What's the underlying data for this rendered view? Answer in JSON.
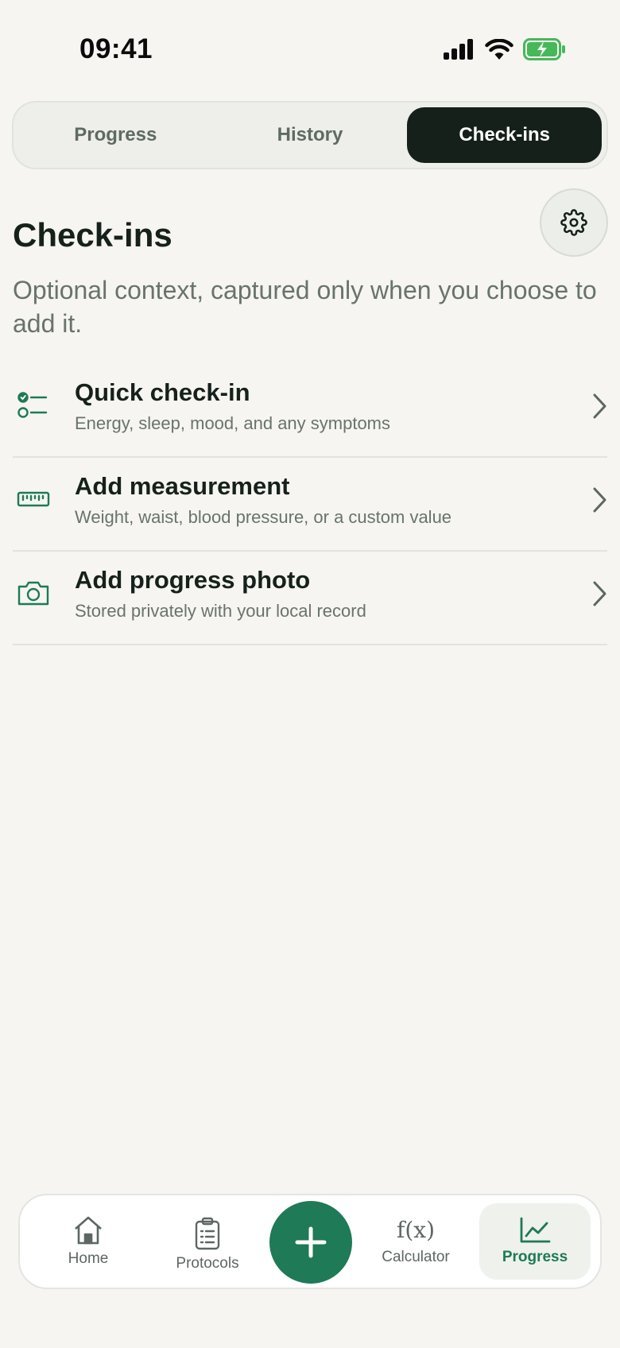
{
  "status_bar": {
    "time": "09:41"
  },
  "segments": [
    {
      "label": "Progress",
      "active": false
    },
    {
      "label": "History",
      "active": false
    },
    {
      "label": "Check-ins",
      "active": true
    }
  ],
  "page": {
    "title": "Check-ins",
    "subtitle": "Optional context, captured only when you choose to add it.",
    "settings_icon": "gear-icon"
  },
  "actions": [
    {
      "icon": "checklist-icon",
      "title": "Quick check-in",
      "description": "Energy, sleep, mood, and any symptoms"
    },
    {
      "icon": "ruler-icon",
      "title": "Add measurement",
      "description": "Weight, waist, blood pressure, or a custom value"
    },
    {
      "icon": "camera-icon",
      "title": "Add progress photo",
      "description": "Stored privately with your local record"
    }
  ],
  "tab_bar": {
    "tabs": [
      {
        "label": "Home",
        "icon": "home-icon"
      },
      {
        "label": "Protocols",
        "icon": "clipboard-icon"
      },
      {
        "label": "Calculator",
        "icon": "function-icon",
        "glyph": "f(x)"
      },
      {
        "label": "Progress",
        "icon": "chart-icon",
        "active": true
      }
    ],
    "fab_icon": "plus-icon"
  },
  "colors": {
    "accent": "#1e7a57",
    "background": "#f6f5f1",
    "active_segment": "#16201b",
    "text_primary": "#16211b",
    "text_secondary": "#69736d"
  }
}
